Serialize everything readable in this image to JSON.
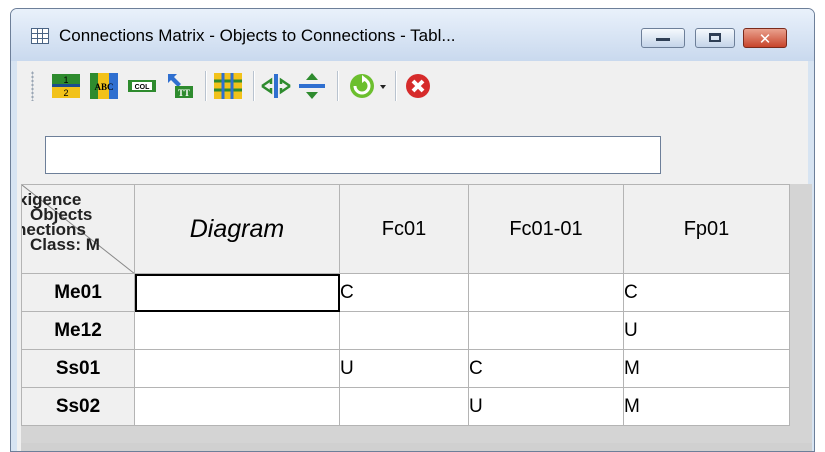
{
  "window": {
    "title": "Connections Matrix - Objects to Connections - Tabl...",
    "buttons": {
      "minimize": "minimize",
      "maximize": "maximize",
      "close": "✕"
    }
  },
  "toolbar": {
    "icons": [
      "numbering-icon",
      "abc-color-icon",
      "column-icon",
      "sort-icon",
      "grid-icon",
      "fit-columns-icon",
      "fit-rows-icon",
      "refresh-icon",
      "delete-icon"
    ],
    "numbering_text": [
      "1",
      "2"
    ],
    "abc_text": "ABC",
    "col_text": "COL",
    "tt_text": "TT"
  },
  "formula_bar": {
    "value": ""
  },
  "corner_header": {
    "lines": [
      "xigence",
      "Objects",
      "nections",
      "Class: M"
    ]
  },
  "matrix": {
    "columns": [
      "Diagram",
      "Fc01",
      "Fc01-01",
      "Fp01"
    ],
    "rows": [
      {
        "label": "Me01",
        "cells": [
          "",
          "C",
          "",
          "C"
        ]
      },
      {
        "label": "Me12",
        "cells": [
          "",
          "",
          "",
          "U"
        ]
      },
      {
        "label": "Ss01",
        "cells": [
          "",
          "U",
          "C",
          "M"
        ]
      },
      {
        "label": "Ss02",
        "cells": [
          "",
          "",
          "U",
          "M"
        ]
      }
    ]
  },
  "colors": {
    "accent": "#2e8b2e",
    "window_frame": "#d7e4f2",
    "close": "#c7442b"
  }
}
